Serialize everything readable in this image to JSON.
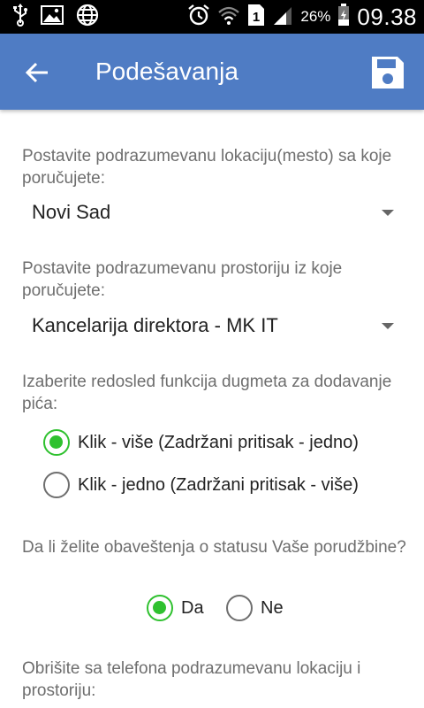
{
  "status_bar": {
    "icons": [
      "usb-icon",
      "image-icon",
      "globe-icon",
      "alarm-icon",
      "wifi-icon",
      "sim-icon",
      "signal-icon",
      "battery-icon"
    ],
    "sim_slot": "1",
    "battery": "26%",
    "time": "09.38"
  },
  "app_bar": {
    "title": "Podešavanja",
    "color": "#4f7cc4"
  },
  "settings": {
    "location_label": "Postavite podrazumevanu lokaciju(mesto) sa koje poručujete:",
    "location_value": "Novi Sad",
    "room_label": "Postavite podrazumevanu prostoriju iz koje poručujete:",
    "room_value": "Kancelarija direktora - MK IT",
    "button_order_label": "Izaberite redosled funkcija dugmeta za dodavanje pića:",
    "button_order_options": [
      {
        "label": "Klik - više (Zadržani pritisak - jedno)",
        "selected": true
      },
      {
        "label": "Klik - jedno (Zadržani pritisak - više)",
        "selected": false
      }
    ],
    "notifications_label": "Da li želite obaveštenja o statusu Vaše porudžbine?",
    "notifications_options": [
      {
        "label": "Da",
        "selected": true
      },
      {
        "label": "Ne",
        "selected": false
      }
    ],
    "clear_label": "Obrišite sa telefona podrazumevanu lokaciju i prostoriju:"
  },
  "colors": {
    "radio_selected": "#2fc12f",
    "label_text": "#6e6e6e"
  }
}
